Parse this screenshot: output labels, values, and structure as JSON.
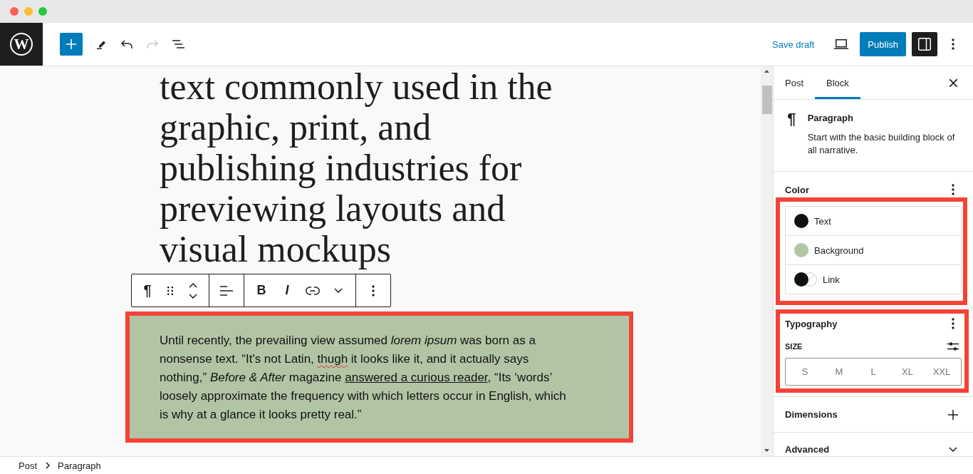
{
  "header": {
    "logo_mark": "W",
    "undo": {
      "disabled": false
    },
    "redo": {
      "disabled": true
    },
    "save_draft": "Save draft",
    "publish": "Publish",
    "settings_toggle": {
      "pressed": true
    }
  },
  "editor": {
    "heading": "text commonly used in the graphic, print, and publishing industries for previewing layouts and visual mockups",
    "block_toolbar": {
      "block_type_icon": "¶",
      "bold_label": "B",
      "italic_label": "I"
    },
    "paragraph": {
      "highlighted": true,
      "segments": [
        {
          "kind": "text",
          "text": "Until recently, the prevailing view assumed "
        },
        {
          "kind": "italic",
          "text": "lorem ipsum"
        },
        {
          "kind": "text",
          "text": " was born as a nonsense text. “It's not Latin, "
        },
        {
          "kind": "misspelled",
          "text": "thugh"
        },
        {
          "kind": "text",
          "text": " it looks like it, and it actually says nothing,” "
        },
        {
          "kind": "italic",
          "text": "Before & After"
        },
        {
          "kind": "text",
          "text": " magazine "
        },
        {
          "kind": "link",
          "text": "answered a curious reader"
        },
        {
          "kind": "text",
          "text": ", “Its ‘words’ loosely approximate the frequency with which letters occur in English, which is why at a glance it looks pretty real.”"
        }
      ]
    }
  },
  "sidebar": {
    "tabs": [
      {
        "label": "Post",
        "selected": false
      },
      {
        "label": "Block",
        "selected": true
      }
    ],
    "block_card": {
      "icon": "¶",
      "title": "Paragraph",
      "description": "Start with the basic building block of all narrative."
    },
    "color_panel": {
      "title": "Color",
      "highlighted": true,
      "items": [
        {
          "kind": "swatch",
          "label": "Text",
          "color": "#111111"
        },
        {
          "kind": "swatch",
          "label": "Background",
          "color": "#b1c5a4"
        },
        {
          "kind": "pair",
          "label": "Link",
          "color": "#111111"
        }
      ]
    },
    "typography_panel": {
      "title": "Typography",
      "highlighted": true,
      "size_label": "SIZE",
      "sizes": [
        {
          "label": "S",
          "selected": false
        },
        {
          "label": "M",
          "selected": false
        },
        {
          "label": "L",
          "selected": false
        },
        {
          "label": "XL",
          "selected": false
        },
        {
          "label": "XXL",
          "selected": false
        }
      ]
    },
    "collapsed_panels": [
      {
        "title": "Dimensions",
        "kind": "tools"
      },
      {
        "title": "Advanced",
        "kind": "toggle"
      }
    ]
  },
  "breadcrumb": [
    "Post",
    "Paragraph"
  ]
}
